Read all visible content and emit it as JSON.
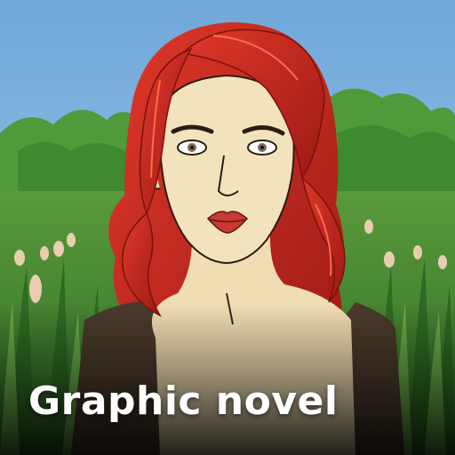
{
  "caption": "Graphic novel",
  "colors": {
    "sky": "#7fb4de",
    "foliage": "#4f9a3a",
    "grass": "#3f7d2b",
    "hair": "#c8261c",
    "skin": "#f3e3bc",
    "top": "#4a3a2c"
  }
}
